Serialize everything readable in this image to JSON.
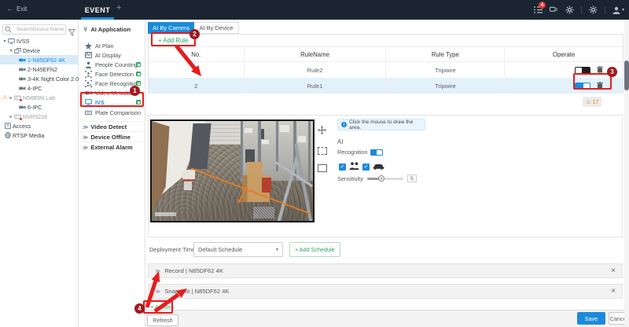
{
  "topbar": {
    "exit_label": "Exit",
    "tab_event": "EVENT",
    "tab_add": "+",
    "task_badge": "4"
  },
  "device_tree": {
    "search_placeholder": "SearchDevice Name/IP",
    "items": [
      {
        "label": "IVSS"
      },
      {
        "label": "Device"
      },
      {
        "label": "1-N85DF62 4K",
        "selected": true
      },
      {
        "label": "2-N45EFN2"
      },
      {
        "label": "3-4K Night Color 2.0"
      },
      {
        "label": "4-IPC"
      },
      {
        "label": "N54B5N Lab",
        "warning": true,
        "offline": true
      },
      {
        "label": "6-IPC"
      },
      {
        "label": "NVR5216",
        "offline": true
      },
      {
        "label": "Access"
      },
      {
        "label": "RTSP Media"
      }
    ]
  },
  "ai_menu": {
    "section_title": "AI Application",
    "items": [
      {
        "label": "AI Plan"
      },
      {
        "label": "AI Display"
      },
      {
        "label": "People Counting",
        "badge": true
      },
      {
        "label": "Face Detection",
        "badge": true
      },
      {
        "label": "Face Recognition",
        "badge": true
      },
      {
        "label": "Video Metadata"
      },
      {
        "label": "IVS",
        "badge": true,
        "active": true
      },
      {
        "label": "Plate Comparison"
      }
    ],
    "sections_collapsed": [
      {
        "label": "Video Detect"
      },
      {
        "label": "Device Offline"
      },
      {
        "label": "External Alarm"
      }
    ]
  },
  "content": {
    "tabs": [
      {
        "label": "AI By Camera",
        "active": true
      },
      {
        "label": "AI By Device",
        "active": false
      }
    ],
    "add_rule_label": "+ Add Rule",
    "table": {
      "columns": [
        "No.",
        "RuleName",
        "Rule Type",
        "Operate"
      ],
      "rows": [
        {
          "no": "1",
          "name": "Rule2",
          "type": "Tripwire",
          "enabled": false
        },
        {
          "no": "2",
          "name": "Rule1",
          "type": "Tripwire",
          "enabled": true,
          "selected": true
        }
      ]
    },
    "warning_count": "17",
    "draw_panel": {
      "hint": "Click the mouse to draw the area.",
      "ai_label": "AI",
      "recognition_label": "Recognition",
      "recognition_on": true,
      "sensitivity_label": "Sensitivity",
      "sensitivity_value": "5"
    },
    "deployment": {
      "label": "Deployment Time",
      "schedule_value": "Default Schedule",
      "add_schedule_label": "+ Add Schedule"
    },
    "link_bars": [
      {
        "label": "Record | N85DF62 4K"
      },
      {
        "label": "Snapshot | N85DF62 4K"
      }
    ],
    "actions_label": "+ Actions",
    "footer": {
      "refresh_label": "Refresh",
      "save_label": "Save",
      "cancel_label": "Cancel"
    }
  },
  "annotations": {
    "step1": "1",
    "step2": "2",
    "step3": "3",
    "step4": "4"
  },
  "icons": {
    "back_arrow": "←",
    "caret_down": "▾",
    "caret_right": "▸",
    "warning": "⚠",
    "chevron_double": "≫",
    "close": "×",
    "check": "✓",
    "info": "i",
    "ai_display_glyph": "AI"
  },
  "colors": {
    "accent_blue": "#1c8adb",
    "accent_green": "#27a35f",
    "annotation_red": "#e61d1d",
    "warning_orange": "#f08519",
    "topbar_bg": "#1b2531",
    "tripwire_orange": "#e87b1e"
  }
}
